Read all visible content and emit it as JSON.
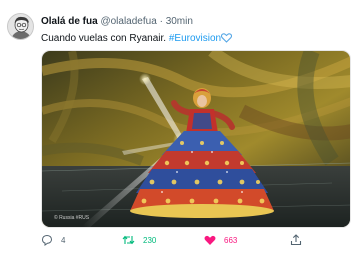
{
  "tweet": {
    "author": {
      "name": "Olalá de fua",
      "handle": "@olaladefua",
      "separator": "·",
      "time": "30min",
      "avatar_icon": "cartoon-avatar-icon"
    },
    "text": "Cuando vuelas con Ryanair. ",
    "hashtag": "#Eurovision",
    "emoji_icon": "blue-heart-icon",
    "media": {
      "watermark": "© Russia #RUS",
      "description_icon": "eurovision-performer-image"
    },
    "actions": {
      "reply": {
        "icon": "reply-icon",
        "count": "4"
      },
      "retweet": {
        "icon": "retweet-icon",
        "count": "230"
      },
      "like": {
        "icon": "heart-icon",
        "count": "663"
      },
      "share": {
        "icon": "share-icon"
      }
    },
    "colors": {
      "accent": "#1d9bf0",
      "retweet": "#00ba7c",
      "like": "#f91880",
      "muted": "#536471"
    }
  }
}
